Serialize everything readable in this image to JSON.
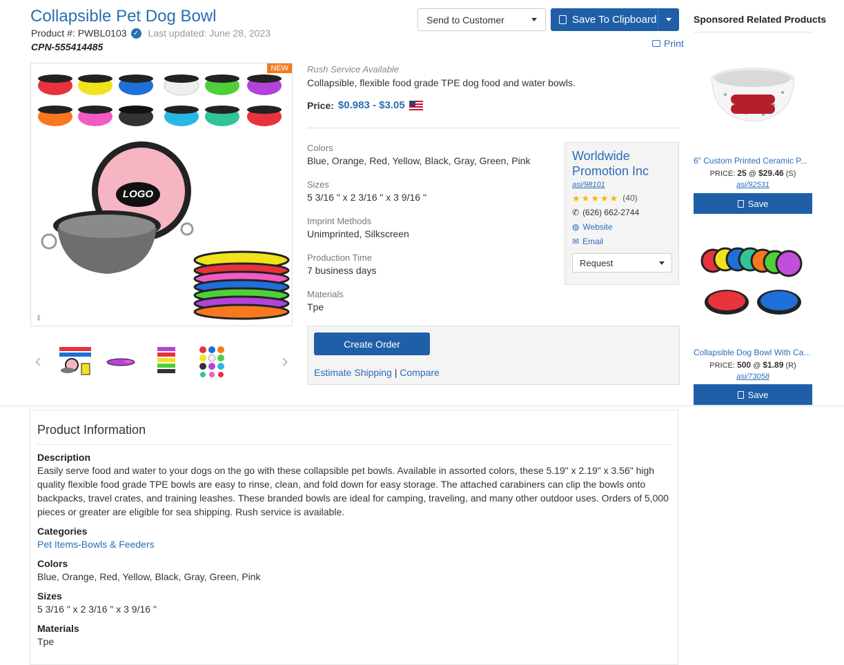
{
  "header": {
    "title": "Collapsible Pet Dog Bowl",
    "product_number_label": "Product #: PWBL0103",
    "last_updated": "Last updated: June 28, 2023",
    "cpn": "CPN-555414485",
    "send_to_customer": "Send to Customer",
    "save_to_clipboard": "Save To Clipboard",
    "print": "Print"
  },
  "gallery": {
    "badge": "NEW",
    "thumb_count": 4
  },
  "summary": {
    "rush": "Rush Service Available",
    "short_description": "Collapsible, flexible food grade TPE dog food and water bowls.",
    "price_label": "Price:",
    "price_value": "$0.983 - $3.05"
  },
  "attributes": [
    {
      "label": "Colors",
      "value": "Blue, Orange, Red, Yellow, Black, Gray, Green, Pink"
    },
    {
      "label": "Sizes",
      "value": "5 3/16 \" x 2 3/16 \" x 3 9/16 \""
    },
    {
      "label": "Imprint Methods",
      "value": "Unimprinted, Silkscreen"
    },
    {
      "label": "Production Time",
      "value": "7 business days"
    },
    {
      "label": "Materials",
      "value": "Tpe"
    }
  ],
  "supplier": {
    "name": "Worldwide Promotion Inc",
    "asi": "asi/98101",
    "rating_count": "(40)",
    "stars": 5,
    "phone": "(626) 662-2744",
    "website": "Website",
    "email": "Email",
    "request": "Request"
  },
  "order": {
    "create_order": "Create Order",
    "estimate_shipping": "Estimate Shipping",
    "separator": "|",
    "compare": "Compare"
  },
  "sponsored": {
    "title": "Sponsored Related Products",
    "items": [
      {
        "name": "6\" Custom Printed Ceramic P...",
        "price_prefix": "PRICE:",
        "qty": "25",
        "at": "@",
        "price": "$29.46",
        "code": "(S)",
        "asi": "asi/92531",
        "save": "Save"
      },
      {
        "name": "Collapsible Dog Bowl With Ca...",
        "price_prefix": "PRICE:",
        "qty": "500",
        "at": "@",
        "price": "$1.89",
        "code": "(R)",
        "asi": "asi/73058",
        "save": "Save"
      }
    ]
  },
  "product_info": {
    "title": "Product Information",
    "description_label": "Description",
    "description": "Easily serve food and water to your dogs on the go with these collapsible pet bowls. Available in assorted colors, these 5.19\" x 2.19\" x 3.56\" high quality flexible food grade TPE bowls are easy to rinse, clean, and fold down for easy storage. The attached carabiners can clip the bowls onto backpacks, travel crates, and training leashes. These branded bowls are ideal for camping, traveling, and many other outdoor uses. Orders of 5,000 pieces or greater are eligible for sea shipping. Rush service is available.",
    "categories_label": "Categories",
    "categories": "Pet Items-Bowls & Feeders",
    "colors_label": "Colors",
    "colors": "Blue, Orange, Red, Yellow, Black, Gray, Green, Pink",
    "sizes_label": "Sizes",
    "sizes": "5 3/16 \" x 2 3/16 \" x 3 9/16 \"",
    "materials_label": "Materials",
    "materials": "Tpe"
  },
  "colors": {
    "accent": "#2a6db5",
    "button": "#1f5fa8",
    "badge": "#f47b20",
    "star": "#f5b800"
  },
  "icons": [
    "verified-check-icon",
    "clipboard-icon",
    "chevron-down-icon",
    "printer-icon",
    "download-icon",
    "chevron-left-icon",
    "chevron-right-icon",
    "phone-icon",
    "globe-icon",
    "envelope-icon",
    "star-icon",
    "us-flag-icon"
  ]
}
